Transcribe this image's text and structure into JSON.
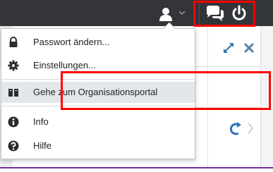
{
  "menu": {
    "items": [
      {
        "label": "Passwort ändern...",
        "icon": "lock-icon"
      },
      {
        "label": "Einstellungen...",
        "icon": "gear-icon"
      },
      {
        "label": "Gehe zum Organisationsportal",
        "icon": "book-icon"
      },
      {
        "label": "Info",
        "icon": "info-icon"
      },
      {
        "label": "Hilfe",
        "icon": "help-icon"
      }
    ]
  },
  "colors": {
    "topbar": "#333538",
    "highlight": "#ff0000",
    "accent_border": "#6f2da8"
  }
}
